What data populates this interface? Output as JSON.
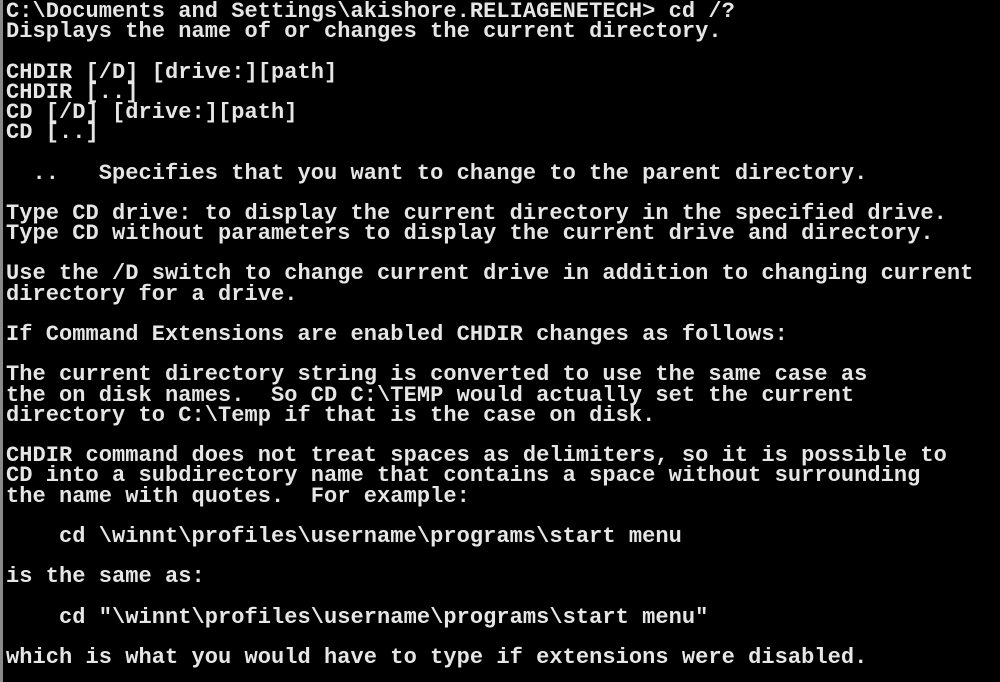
{
  "console": {
    "lines": [
      "C:\\Documents and Settings\\akishore.RELIAGENETECH> cd /?",
      "Displays the name of or changes the current directory.",
      "",
      "CHDIR [/D] [drive:][path]",
      "CHDIR [..]",
      "CD [/D] [drive:][path]",
      "CD [..]",
      "",
      "  ..   Specifies that you want to change to the parent directory.",
      "",
      "Type CD drive: to display the current directory in the specified drive.",
      "Type CD without parameters to display the current drive and directory.",
      "",
      "Use the /D switch to change current drive in addition to changing current",
      "directory for a drive.",
      "",
      "If Command Extensions are enabled CHDIR changes as follows:",
      "",
      "The current directory string is converted to use the same case as",
      "the on disk names.  So CD C:\\TEMP would actually set the current",
      "directory to C:\\Temp if that is the case on disk.",
      "",
      "CHDIR command does not treat spaces as delimiters, so it is possible to",
      "CD into a subdirectory name that contains a space without surrounding",
      "the name with quotes.  For example:",
      "",
      "    cd \\winnt\\profiles\\username\\programs\\start menu",
      "",
      "is the same as:",
      "",
      "    cd \"\\winnt\\profiles\\username\\programs\\start menu\"",
      "",
      "which is what you would have to type if extensions were disabled."
    ]
  }
}
